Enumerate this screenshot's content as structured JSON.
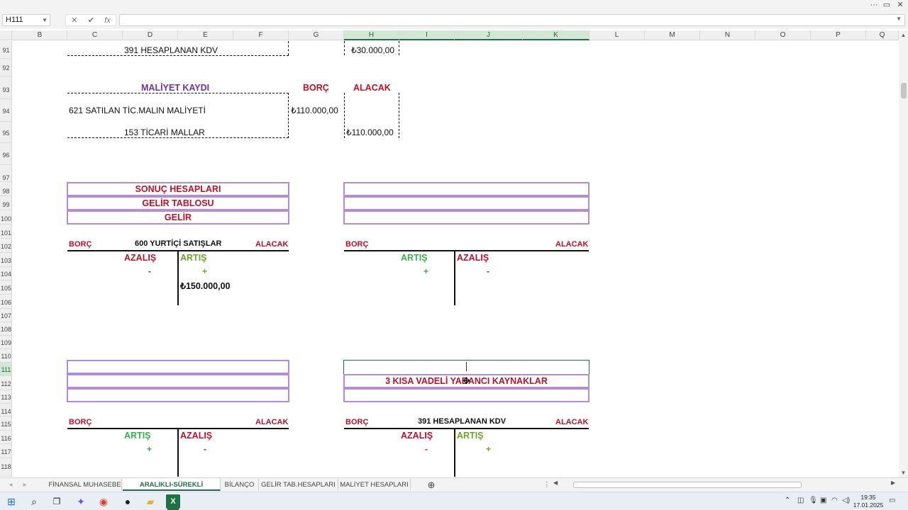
{
  "window": {
    "controls": [
      "···",
      "▭",
      "✕"
    ]
  },
  "formula_bar": {
    "name_box": "H111",
    "cancel_icon": "✕",
    "enter_icon": "✔",
    "fx_label": "fx",
    "value": ""
  },
  "columns": [
    "B",
    "C",
    "D",
    "E",
    "F",
    "G",
    "H",
    "I",
    "J",
    "K",
    "L",
    "M",
    "N",
    "O",
    "P",
    "Q"
  ],
  "rows": [
    "91",
    "92",
    "93",
    "94",
    "95",
    "96",
    "97",
    "98",
    "99",
    "100",
    "101",
    "102",
    "103",
    "104",
    "105",
    "106",
    "107",
    "108",
    "109",
    "110",
    "111",
    "112",
    "113",
    "114",
    "115",
    "116",
    "117",
    "118"
  ],
  "cells": {
    "kdv_391": "391 HESAPLANAN KDV",
    "kdv_amount": "₺30.000,00",
    "maliyet_title": "MALİYET KAYDI",
    "borc_head": "BORÇ",
    "alacak_head": "ALACAK",
    "acc_621": "621 SATILAN TİC.MALIN MALİYETİ",
    "acc_621_amount": "₺110.000,00",
    "acc_153": "153 TİCARİ MALLAR",
    "acc_153_amount": "₺110.000,00"
  },
  "box_left_top": {
    "line1": "SONUÇ HESAPLARI",
    "line2": "GELİR TABLOSU",
    "line3": "GELİR"
  },
  "box_right_mid": {
    "line1": "",
    "line2": "3 KISA VADELİ YABANCI KAYNAKLAR",
    "line3": ""
  },
  "t_account_600": {
    "borc": "BORÇ",
    "title": "600 YURTİÇİ SATIŞLAR",
    "alacak": "ALACAK",
    "left_label": "AZALIŞ",
    "left_sign": "-",
    "right_label": "ARTIŞ",
    "right_sign": "+",
    "amount": "₺150.000,00"
  },
  "t_account_right_top": {
    "borc": "BORÇ",
    "title": "",
    "alacak": "ALACAK",
    "left_label": "ARTIŞ",
    "left_sign": "+",
    "right_label": "AZALIŞ",
    "right_sign": "-"
  },
  "t_account_left_bottom": {
    "borc": "BORÇ",
    "title": "",
    "alacak": "ALACAK",
    "left_label": "ARTIŞ",
    "left_sign": "+",
    "right_label": "AZALIŞ",
    "right_sign": "-"
  },
  "t_account_391": {
    "borc": "BORÇ",
    "title": "391 HESAPLANAN KDV",
    "alacak": "ALACAK",
    "left_label": "AZALIŞ",
    "left_sign": "-",
    "right_label": "ARTIŞ",
    "right_sign": "+"
  },
  "sheet_tabs": [
    "FİNANSAL MUHASEBE",
    "ARALIKLI-SÜREKLİ ENVANTER",
    "BİLANÇO",
    "GELİR TAB.HESAPLARI",
    "MALİYET HESAPLARI"
  ],
  "active_tab_index": 1,
  "taskbar": {
    "time": "19:35",
    "date": "17.01.2025"
  },
  "colors": {
    "accent_green": "#1e7145",
    "red_text": "#c0102a",
    "purple_text": "#7030a0",
    "box_border": "#b48cd8"
  }
}
